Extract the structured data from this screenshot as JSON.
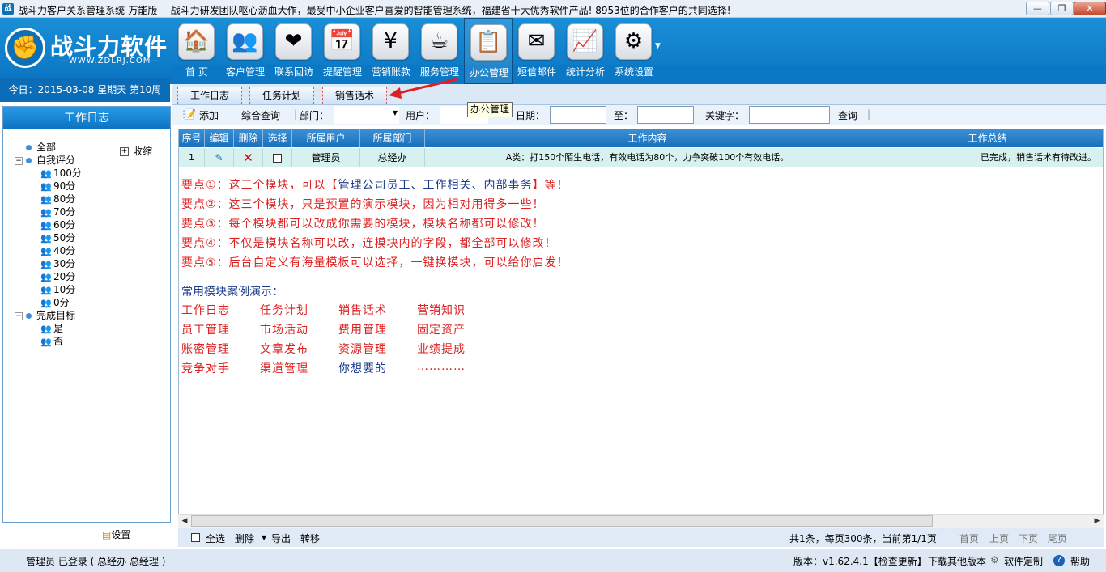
{
  "window": {
    "title": "战斗力客户关系管理系统-万能版 -- 战斗力研发团队呕心沥血大作，最受中小企业客户喜爱的智能管理系统，福建省十大优秀软件产品! 8953位的合作客户的共同选择!",
    "minimize": "—",
    "maximize": "❐",
    "close": "✕"
  },
  "logo": {
    "name": "战斗力软件",
    "url": "—WWW.ZDLRJ.COM—"
  },
  "today": "今日：2015-03-08  星期天  第10周",
  "toolbar": [
    {
      "label": "首 页",
      "icon": "home-icon",
      "glyph": "🏠"
    },
    {
      "label": "客户管理",
      "icon": "customers-icon",
      "glyph": "👥"
    },
    {
      "label": "联系回访",
      "icon": "heart-icon",
      "glyph": "❤"
    },
    {
      "label": "提醒管理",
      "icon": "calendar-icon",
      "glyph": "📅"
    },
    {
      "label": "营销账款",
      "icon": "yen-icon",
      "glyph": "¥"
    },
    {
      "label": "服务管理",
      "icon": "coffee-icon",
      "glyph": "☕"
    },
    {
      "label": "办公管理",
      "icon": "checklist-icon",
      "glyph": "📋"
    },
    {
      "label": "短信邮件",
      "icon": "mail-icon",
      "glyph": "✉"
    },
    {
      "label": "统计分析",
      "icon": "chart-icon",
      "glyph": "📈"
    },
    {
      "label": "系统设置",
      "icon": "gear-icon",
      "glyph": "⚙"
    }
  ],
  "left": {
    "title": "工作日志",
    "collapse": "收缩",
    "settings": "设置",
    "tree": [
      {
        "label": "全部",
        "level": 0,
        "type": "dot"
      },
      {
        "label": "自我评分",
        "level": 0,
        "type": "dot",
        "toggle": "−"
      },
      {
        "label": "100分",
        "level": 1,
        "type": "user"
      },
      {
        "label": "90分",
        "level": 1,
        "type": "user"
      },
      {
        "label": "80分",
        "level": 1,
        "type": "user"
      },
      {
        "label": "70分",
        "level": 1,
        "type": "user"
      },
      {
        "label": "60分",
        "level": 1,
        "type": "user"
      },
      {
        "label": "50分",
        "level": 1,
        "type": "user"
      },
      {
        "label": "40分",
        "level": 1,
        "type": "user"
      },
      {
        "label": "30分",
        "level": 1,
        "type": "user"
      },
      {
        "label": "20分",
        "level": 1,
        "type": "user"
      },
      {
        "label": "10分",
        "level": 1,
        "type": "user"
      },
      {
        "label": "0分",
        "level": 1,
        "type": "user"
      },
      {
        "label": "完成目标",
        "level": 0,
        "type": "dot",
        "toggle": "−"
      },
      {
        "label": "是",
        "level": 1,
        "type": "user"
      },
      {
        "label": "否",
        "level": 1,
        "type": "user"
      }
    ]
  },
  "tabs": [
    "工作日志",
    "任务计划",
    "销售话术"
  ],
  "tooltip": "办公管理",
  "filter": {
    "add": "添加",
    "query_all": "综合查询",
    "dept_label": "部门：",
    "user_label": "用户：",
    "date_label": "日期：",
    "to_label": "至：",
    "keyword_label": "关键字：",
    "search": "查询"
  },
  "grid": {
    "headers": [
      "序号",
      "编辑",
      "删除",
      "选择",
      "所属用户",
      "所属部门",
      "工作内容",
      "工作总结"
    ],
    "rows": [
      {
        "no": "1",
        "user": "管理员",
        "dept": "总经办",
        "content": "A类：打150个陌生电话，有效电话为80个，力争突破100个有效电话。",
        "summary": "已完成，销售话术有待改进。"
      }
    ]
  },
  "notes": [
    {
      "prefix": "要点①：这三个模块，可以【",
      "blue": "管理公司员工、工作相关、内部事务",
      "suffix": "】等！"
    },
    {
      "prefix": "要点②：这三个模块，只是预置的演示模块，因为相对用得多一些！",
      "blue": "",
      "suffix": ""
    },
    {
      "prefix": "要点③：每个模块都可以改成你需要的模块，模块名称都可以修改！",
      "blue": "",
      "suffix": ""
    },
    {
      "prefix": "要点④：不仅是模块名称可以改，连模块内的字段，都全部可以修改！",
      "blue": "",
      "suffix": ""
    },
    {
      "prefix": "要点⑤：后台自定义有海量模板可以选择，一键换模块，可以给你启发！",
      "blue": "",
      "suffix": ""
    }
  ],
  "examples_title": "常用模块案例演示：",
  "examples": [
    [
      "工作日志",
      "任务计划",
      "销售话术",
      "营销知识"
    ],
    [
      "员工管理",
      "市场活动",
      "费用管理",
      "固定资产"
    ],
    [
      "账密管理",
      "文章发布",
      "资源管理",
      "业绩提成"
    ],
    [
      "竞争对手",
      "渠道管理",
      "你想要的",
      "…………"
    ]
  ],
  "pager": {
    "select_all": "全选",
    "delete": "删除",
    "export": "导出",
    "transfer": "转移",
    "summary": "共1条，每页300条，当前第1/1页",
    "first": "首页",
    "prev": "上页",
    "next": "下页",
    "last": "尾页"
  },
  "status": {
    "user": "管理员 已登录 ( 总经办 总经理 )",
    "version": "版本：v1.62.4.1【检查更新】",
    "download": "下载其他版本",
    "custom": "软件定制",
    "help": "帮助"
  }
}
